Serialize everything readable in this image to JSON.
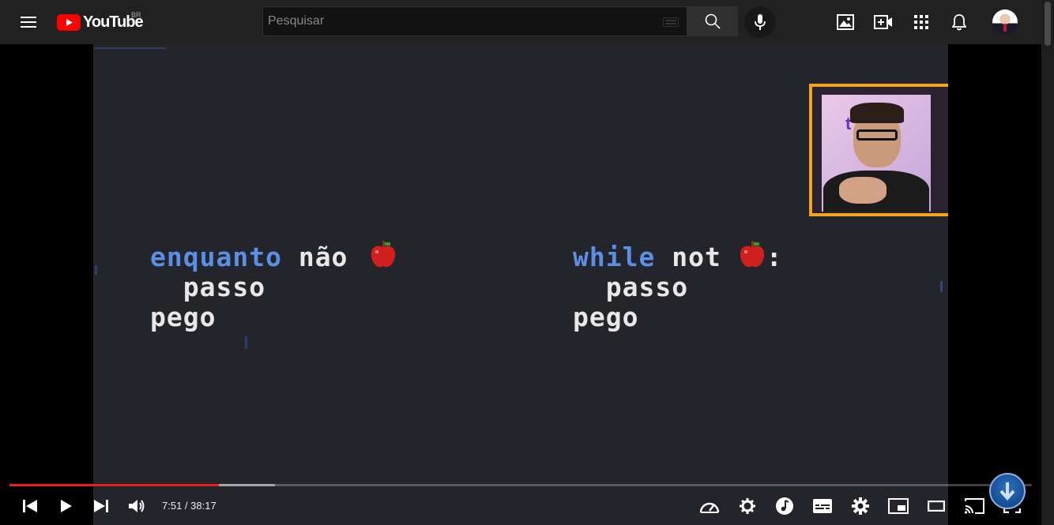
{
  "header": {
    "logo_text": "YouTube",
    "country_code": "BR",
    "search": {
      "placeholder": "Pesquisar",
      "value": ""
    },
    "icons": [
      "menu-icon",
      "keyboard-icon",
      "search-icon",
      "mic-icon",
      "create-post-icon",
      "create-video-icon",
      "apps-icon",
      "notifications-icon"
    ]
  },
  "video": {
    "code_pt": {
      "keyword": "enquanto",
      "rest": " não ",
      "line2": "  passo",
      "line3": "pego"
    },
    "code_en": {
      "keyword": "while",
      "rest": " not ",
      "colon": ":",
      "line2": "  passo",
      "line3": "pego"
    },
    "webcam_logo": "t      t"
  },
  "player": {
    "current_time": "7:51",
    "separator": " / ",
    "duration": "38:17",
    "progress_played_fraction": 0.205,
    "progress_buffered_fraction": 0.26,
    "played_color": "#e81f1f",
    "controls_left": [
      "previous-icon",
      "play-icon",
      "next-icon",
      "volume-icon"
    ],
    "controls_right": [
      "playback-speed-icon",
      "autoplay-settings-icon",
      "music-icon",
      "subtitles-icon",
      "settings-icon",
      "miniplayer-icon",
      "theater-mode-icon",
      "cast-icon",
      "fullscreen-icon"
    ]
  },
  "colors": {
    "topbar": "#212121",
    "accent": "#ff0000",
    "keyword": "#5b8fe6",
    "cam_border": "#f2a51c"
  }
}
